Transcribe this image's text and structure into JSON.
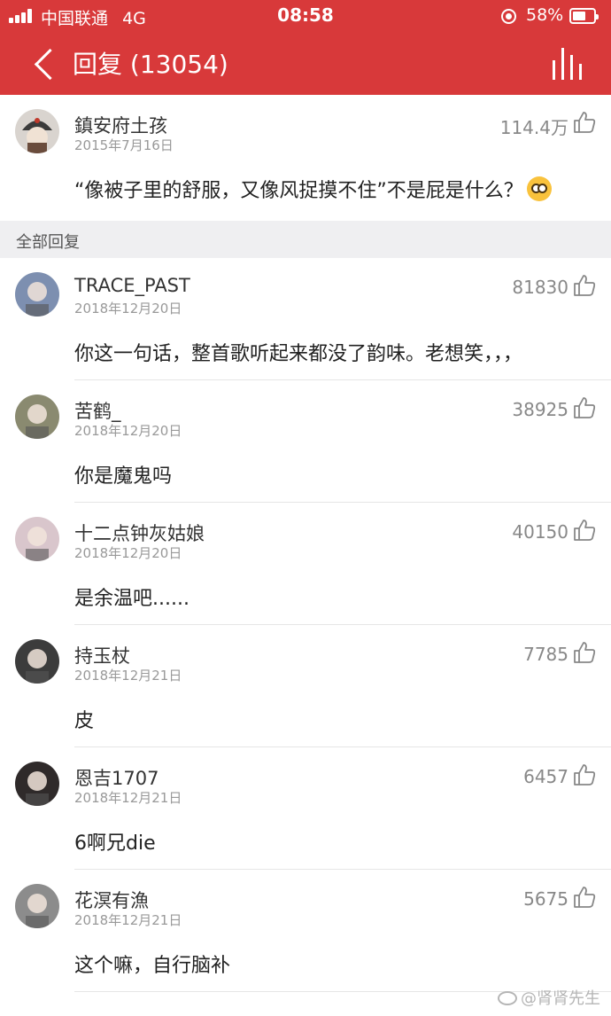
{
  "status_bar": {
    "carrier": "中国联通",
    "network": "4G",
    "time": "08:58",
    "battery": "58%"
  },
  "header": {
    "title": "回复 (13054)",
    "back_icon": "chevron-left-icon",
    "right_icon": "chart-bars-icon"
  },
  "hot_comment": {
    "user": "鎮安府土孩",
    "date": "2015年7月16日",
    "likes": "114.4万",
    "text": "“像被子里的舒服，又像风捉摸不住”不是屁是什么？",
    "emoji": "flushed-face-icon"
  },
  "section_title": "全部回复",
  "comments": [
    {
      "user": "TRACE_PAST",
      "date": "2018年12月20日",
      "likes": "81830",
      "text": "你这一句话，整首歌听起来都没了韵味。老想笑，，，",
      "avatar_color": "#7d8fb0"
    },
    {
      "user": "苦鹤_",
      "date": "2018年12月20日",
      "likes": "38925",
      "text": "你是魔鬼吗",
      "avatar_color": "#8a8a70"
    },
    {
      "user": "十二点钟灰姑娘",
      "date": "2018年12月20日",
      "likes": "40150",
      "text": "是余温吧......",
      "avatar_color": "#d9c6cc"
    },
    {
      "user": "持玉杖",
      "date": "2018年12月21日",
      "likes": "7785",
      "text": "皮",
      "avatar_color": "#3c3c3c"
    },
    {
      "user": "恩吉1707",
      "date": "2018年12月21日",
      "likes": "6457",
      "text": "6啊兄die",
      "avatar_color": "#2f2a2a"
    },
    {
      "user": "花溟有漁",
      "date": "2018年12月21日",
      "likes": "5675",
      "text": "这个嘛，自行脑补",
      "avatar_color": "#8c8c8c"
    }
  ],
  "watermark": "@肾肾先生",
  "colors": {
    "header_red": "#d8393a",
    "section_bg": "#efeff1"
  }
}
